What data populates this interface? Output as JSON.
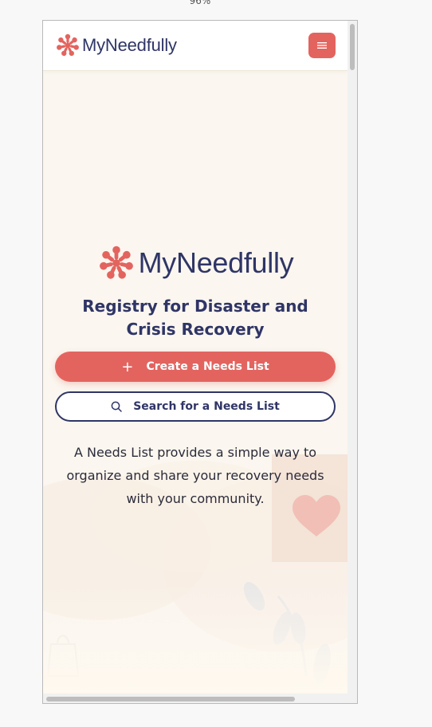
{
  "browser": {
    "zoom": "96%"
  },
  "header": {
    "logo_text": "MyNeedfully",
    "menu_icon": "hamburger-icon"
  },
  "hero": {
    "logo_text": "MyNeedfully",
    "headline": "Registry for Disaster and Crisis Recovery",
    "create_button": "Create a Needs List",
    "search_button": "Search for a Needs List",
    "description": "A Needs List provides a simple way to organize and share your recovery needs with your community."
  },
  "colors": {
    "brand_coral": "#e3645f",
    "brand_navy": "#2f3566",
    "page_bg": "#fbf7f1"
  }
}
